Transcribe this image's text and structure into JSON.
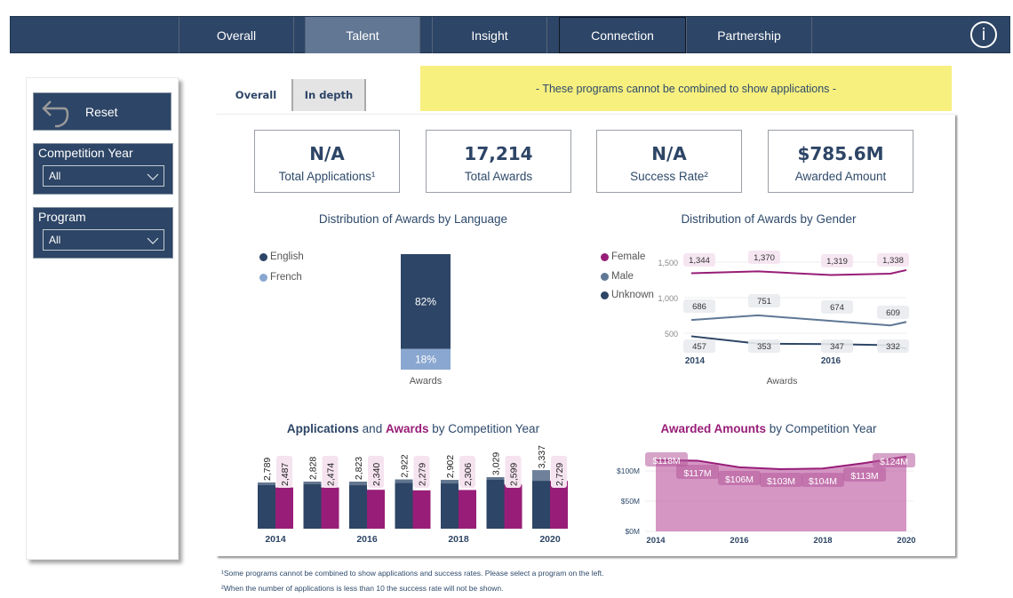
{
  "nav": {
    "tabs": [
      {
        "label": "Overall",
        "state": "normal"
      },
      {
        "label": "Talent",
        "state": "active"
      },
      {
        "label": "Insight",
        "state": "normal"
      },
      {
        "label": "Connection",
        "state": "outlined"
      },
      {
        "label": "Partnership",
        "state": "normal"
      }
    ],
    "info_icon": "info-circle-icon",
    "info_glyph": "i"
  },
  "sidebar": {
    "reset_label": "Reset",
    "reset_icon": "undo-arrow-icon",
    "slicers": [
      {
        "label": "Competition Year",
        "value": "All"
      },
      {
        "label": "Program",
        "value": "All"
      }
    ]
  },
  "subtabs": [
    {
      "label": "Overall",
      "active": true
    },
    {
      "label": "In depth",
      "active": false
    }
  ],
  "banner": "- These programs cannot be combined to show applications -",
  "kpis": [
    {
      "value": "N/A",
      "label": "Total Applications¹"
    },
    {
      "value": "17,214",
      "label": "Total Awards"
    },
    {
      "value": "N/A",
      "label": "Success Rate²"
    },
    {
      "value": "$785.6M",
      "label": "Awarded Amount"
    }
  ],
  "colors": {
    "navy": "#2d4566",
    "plum": "#981d78",
    "light_blue": "#89a7d0",
    "slate": "#5f7895",
    "banner_yellow": "#f7f07e",
    "active_tab": "#617793"
  },
  "chart_data": [
    {
      "id": "language",
      "type": "bar",
      "stacked": true,
      "title": "Distribution of Awards by Language",
      "categories": [
        "Awards"
      ],
      "series": [
        {
          "name": "English",
          "values": [
            82
          ],
          "label": "82%",
          "color": "#2d4566"
        },
        {
          "name": "French",
          "values": [
            18
          ],
          "label": "18%",
          "color": "#89a7d0"
        }
      ],
      "unit": "%",
      "legend": "top-left"
    },
    {
      "id": "gender",
      "type": "line",
      "title": "Distribution of Awards by Gender",
      "xlabel": "Awards",
      "x": [
        2014,
        2015,
        2016,
        2017
      ],
      "x_tick_labels": [
        "2014",
        "2016"
      ],
      "y_ticks": [
        "500",
        "1,000",
        "1,500"
      ],
      "ylim": [
        250,
        1600
      ],
      "series": [
        {
          "name": "Female",
          "color": "#981d78",
          "values": [
            1344,
            1370,
            1319,
            1338
          ],
          "labels": [
            "1,344",
            "1,370",
            "1,319",
            "1,338"
          ]
        },
        {
          "name": "Male",
          "color": "#5f7895",
          "values": [
            686,
            751,
            674,
            609
          ],
          "labels": [
            "686",
            "751",
            "674",
            "609"
          ]
        },
        {
          "name": "Unknown",
          "color": "#2d4566",
          "values": [
            457,
            353,
            347,
            332
          ],
          "labels": [
            "457",
            "353",
            "347",
            "332"
          ]
        }
      ],
      "legend": "top-left"
    },
    {
      "id": "apps_awards",
      "type": "bar",
      "title_parts": [
        {
          "text": "Applications",
          "style": "navy"
        },
        {
          "text": " and ",
          "style": "plain"
        },
        {
          "text": "Awards",
          "style": "plum"
        },
        {
          "text": " by Competition Year",
          "style": "plain"
        }
      ],
      "categories": [
        "2014",
        "2015",
        "2016",
        "2017",
        "2018",
        "2019",
        "2020"
      ],
      "x_tick_labels": [
        "2014",
        "",
        "2016",
        "",
        "2018",
        "",
        "2020"
      ],
      "series": [
        {
          "name": "Applications",
          "color": "#2d4566",
          "values": [
            2789,
            2828,
            2823,
            2922,
            2902,
            3029,
            3337
          ],
          "labels": [
            "2,789",
            "2,828",
            "2,823",
            "2,922",
            "2,902",
            "3,029",
            "3,337"
          ]
        },
        {
          "name": "Awards",
          "color": "#981d78",
          "values": [
            2487,
            2474,
            2340,
            2279,
            2306,
            2599,
            2729
          ],
          "labels": [
            "2,487",
            "2,474",
            "2,340",
            "2,279",
            "2,306",
            "2,599",
            "2,729"
          ]
        }
      ],
      "ylim": [
        0,
        3500
      ]
    },
    {
      "id": "amounts",
      "type": "area",
      "title_parts": [
        {
          "text": "Awarded Amounts",
          "style": "plum"
        },
        {
          "text": " by Competition Year",
          "style": "plain"
        }
      ],
      "x": [
        2014,
        2015,
        2016,
        2017,
        2018,
        2019,
        2020
      ],
      "x_tick_labels": [
        "2014",
        "",
        "2016",
        "",
        "2018",
        "",
        "2020"
      ],
      "y_ticks": [
        "$0M",
        "$50M",
        "$100M"
      ],
      "ylim": [
        0,
        125
      ],
      "values": [
        118,
        117,
        106,
        103,
        104,
        113,
        124
      ],
      "labels": [
        "$118M",
        "$117M",
        "$106M",
        "$103M",
        "$104M",
        "$113M",
        "$124M"
      ],
      "color": "#981d78"
    }
  ],
  "footnotes": [
    "¹Some programs cannot be combined to show applications and success rates. Please select a program on the left.",
    "²When the number of applications is less than 10 the success rate will not be shown."
  ]
}
